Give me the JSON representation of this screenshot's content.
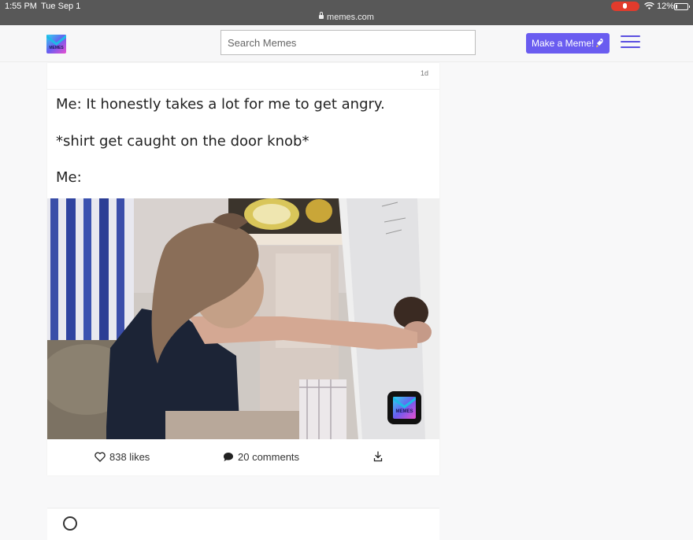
{
  "status_bar": {
    "time": "1:55 PM",
    "date": "Tue Sep 1",
    "url": "memes.com",
    "battery": "12%",
    "mic_color": "#e23b2c"
  },
  "header": {
    "logo_text": "MEMES",
    "search_placeholder": "Search Memes",
    "make_button": "Make a Meme!",
    "accent_color": "#6a5cf0",
    "menu_icon": "hamburger-icon"
  },
  "post": {
    "age": "1d",
    "caption_lines": [
      "Me: It honestly takes a lot for me to get angry.",
      "*shirt get caught on the door knob*",
      "Me:"
    ],
    "watermark_text": "MEMES",
    "likes": "838 likes",
    "comments": "20 comments",
    "icons": [
      "heart-icon",
      "comment-icon",
      "download-icon"
    ]
  }
}
